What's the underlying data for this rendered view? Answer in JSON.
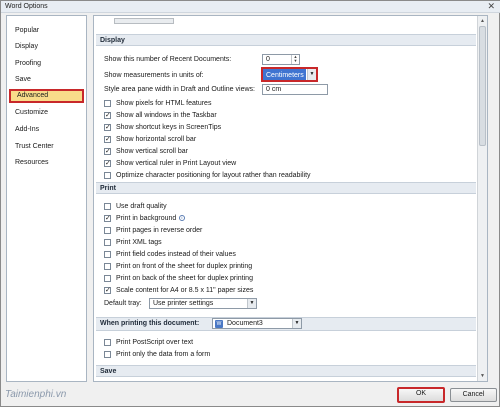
{
  "window": {
    "title": "Word Options",
    "close_glyph": "✕"
  },
  "nav": {
    "items": [
      {
        "label": "Popular"
      },
      {
        "label": "Display"
      },
      {
        "label": "Proofing"
      },
      {
        "label": "Save"
      },
      {
        "label": "Advanced",
        "selected": true
      },
      {
        "label": "Customize"
      },
      {
        "label": "Add-Ins"
      },
      {
        "label": "Trust Center"
      },
      {
        "label": "Resources"
      }
    ]
  },
  "display": {
    "header": "Display",
    "recent_docs_label": "Show this number of Recent Documents:",
    "recent_docs_value": "0",
    "units_label": "Show measurements in units of:",
    "units_value": "Centimeters",
    "style_pane_label": "Style area pane width in Draft and Outline views:",
    "style_pane_value": "0 cm",
    "checkboxes": [
      {
        "label": "Show pixels for HTML features",
        "checked": false
      },
      {
        "label": "Show all windows in the Taskbar",
        "checked": true
      },
      {
        "label": "Show shortcut keys in ScreenTips",
        "checked": true
      },
      {
        "label": "Show horizontal scroll bar",
        "checked": true
      },
      {
        "label": "Show vertical scroll bar",
        "checked": true
      },
      {
        "label": "Show vertical ruler in Print Layout view",
        "checked": true
      },
      {
        "label": "Optimize character positioning for layout rather than readability",
        "checked": false
      }
    ]
  },
  "print": {
    "header": "Print",
    "checkboxes": [
      {
        "label": "Use draft quality",
        "checked": false
      },
      {
        "label": "Print in background",
        "checked": true
      },
      {
        "label": "Print pages in reverse order",
        "checked": false
      },
      {
        "label": "Print XML tags",
        "checked": false
      },
      {
        "label": "Print field codes instead of their values",
        "checked": false
      },
      {
        "label": "Print on front of the sheet for duplex printing",
        "checked": false
      },
      {
        "label": "Print on back of the sheet for duplex printing",
        "checked": false
      },
      {
        "label": "Scale content for A4 or 8.5 x 11\" paper sizes",
        "checked": true
      }
    ],
    "tray_label": "Default tray:",
    "tray_value": "Use printer settings"
  },
  "when_printing": {
    "header": "When printing this document:",
    "document_value": "Document3",
    "checkboxes": [
      {
        "label": "Print PostScript over text",
        "checked": false
      },
      {
        "label": "Print only the data from a form",
        "checked": false
      }
    ]
  },
  "save": {
    "header": "Save"
  },
  "footer": {
    "ok_label": "OK",
    "cancel_label": "Cancel"
  },
  "watermark": "Taimienphi.vn",
  "icons": {
    "info": "info-icon",
    "document": "word-document-icon",
    "dropdown": "chevron-down-icon",
    "spin": "spin-arrows-icon"
  },
  "colors": {
    "highlight": "#c8282a",
    "selected_nav": "#f9dc8a",
    "accent": "#3e74d1"
  }
}
